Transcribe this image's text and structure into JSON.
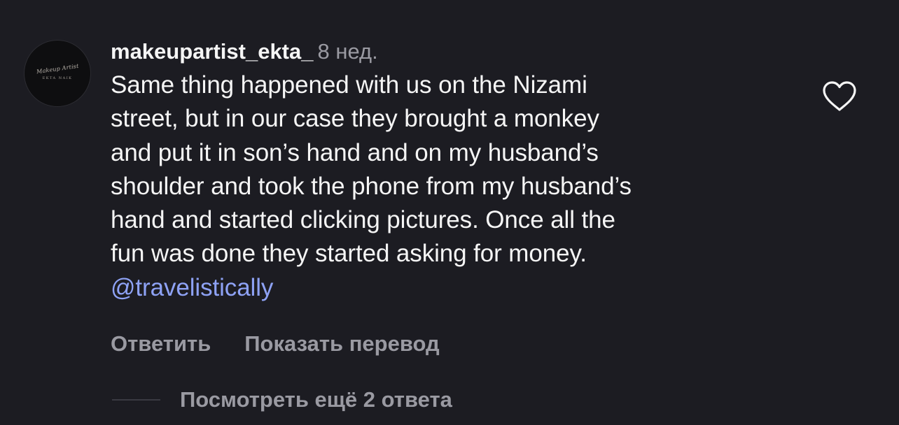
{
  "comment": {
    "avatar": {
      "icon": "profile-avatar",
      "script_text": "Makeup Artist",
      "sub_text": "EKTA NAIK"
    },
    "username": "makeupartist_ekta_",
    "time": "8 нед.",
    "text_lines": [
      "Same thing happened with us on the Nizami",
      "street, but in our case they brought a monkey",
      "and put it in son’s hand and on my husband’s",
      "shoulder and took the phone from my husband’s",
      "hand and started clicking pictures. Once all the",
      "fun was done they started asking for money."
    ],
    "mention": "@travelistically",
    "like_icon": "heart-outline-icon",
    "actions": {
      "reply": "Ответить",
      "translate": "Показать перевод"
    },
    "view_replies": "Посмотреть ещё 2 ответа"
  },
  "colors": {
    "background": "#1c1c22",
    "text_primary": "#f5f5f5",
    "text_secondary": "#9a9aa2",
    "mention": "#8ea2f5"
  }
}
